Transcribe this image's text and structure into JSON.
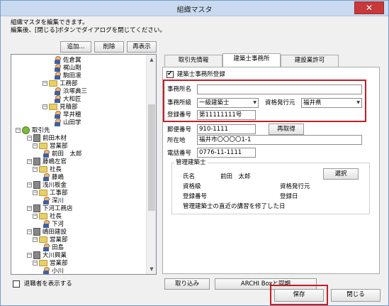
{
  "window": {
    "title": "組織マスタ",
    "close_symbol": "✕"
  },
  "instructions": [
    "組織マスタを編集できます。",
    "編集後、[閉じる]ボタンでダイアログを閉じてください。"
  ],
  "toolbar": {
    "add": "追加...",
    "delete": "削除",
    "redisplay": "再表示"
  },
  "tree": [
    {
      "text": "佐倉翼",
      "type": "person",
      "level": 4
    },
    {
      "text": "梶山剛",
      "type": "person",
      "level": 4
    },
    {
      "text": "駒田凛",
      "type": "person",
      "level": 4
    },
    {
      "text": "工務部",
      "type": "folder",
      "level": 3
    },
    {
      "text": "浜塚典三",
      "type": "person",
      "level": 4
    },
    {
      "text": "大和匠",
      "type": "person",
      "level": 4
    },
    {
      "text": "見積部",
      "type": "folder",
      "level": 3
    },
    {
      "text": "早井穂",
      "type": "person",
      "level": 4
    },
    {
      "text": "山田学",
      "type": "person",
      "level": 4
    },
    {
      "text": "取引先",
      "type": "globe",
      "level": 0
    },
    {
      "text": "前田木材",
      "type": "building",
      "level": 1
    },
    {
      "text": "営業部",
      "type": "folder",
      "level": 2
    },
    {
      "text": "前田　太郎",
      "type": "person",
      "level": 3
    },
    {
      "text": "藤嶋左官",
      "type": "building",
      "level": 1
    },
    {
      "text": "社長",
      "type": "folder",
      "level": 2
    },
    {
      "text": "藤嶋",
      "type": "person",
      "level": 3
    },
    {
      "text": "浅川板金",
      "type": "building",
      "level": 1
    },
    {
      "text": "工事部",
      "type": "folder",
      "level": 2
    },
    {
      "text": "深川",
      "type": "person",
      "level": 3
    },
    {
      "text": "下河工務店",
      "type": "building",
      "level": 1
    },
    {
      "text": "社長",
      "type": "folder",
      "level": 2
    },
    {
      "text": "下河",
      "type": "person",
      "level": 3
    },
    {
      "text": "嶋田建設",
      "type": "building",
      "level": 1
    },
    {
      "text": "営業部",
      "type": "folder",
      "level": 2
    },
    {
      "text": "田島",
      "type": "person",
      "level": 3
    },
    {
      "text": "大川興業",
      "type": "building",
      "level": 1
    },
    {
      "text": "営業部",
      "type": "folder",
      "level": 2
    },
    {
      "text": "小川",
      "type": "person",
      "level": 3
    }
  ],
  "show_retired": "退職者を表示する",
  "tabs": [
    "取引先情報",
    "建築士事務所",
    "建設業許可"
  ],
  "form": {
    "register_label": "建築士事務所登録",
    "office_name_label": "事務所名",
    "office_name": "",
    "office_grade_label": "事務所級",
    "office_grade": "一級建築士",
    "issuer_label": "資格発行元",
    "issuer": "福井県",
    "reg_no_label": "登録番号",
    "reg_no": "第11111111号",
    "zip_label": "郵便番号",
    "zip": "910-1111",
    "reacquire": "再取得",
    "address_label": "所在地",
    "address": "福井市〇〇〇〇1-1",
    "phone_label": "電話番号",
    "phone": "0776-11-1111",
    "manager_group": "管理建築士",
    "select": "選択",
    "name_label": "氏名",
    "name": "前田　太郎",
    "grade_label": "資格級",
    "issuer2_label": "資格発行元",
    "reg_no2_label": "登録番号",
    "reg_date_label": "登録日",
    "course_label": "管理建築士の直近の講習を修了した日"
  },
  "bottom": {
    "import": "取り込み",
    "sync": "ARCHI Boxと同期",
    "save": "保存",
    "close": "閉じる"
  },
  "colors": {
    "highlight_red": "#c41e25"
  }
}
